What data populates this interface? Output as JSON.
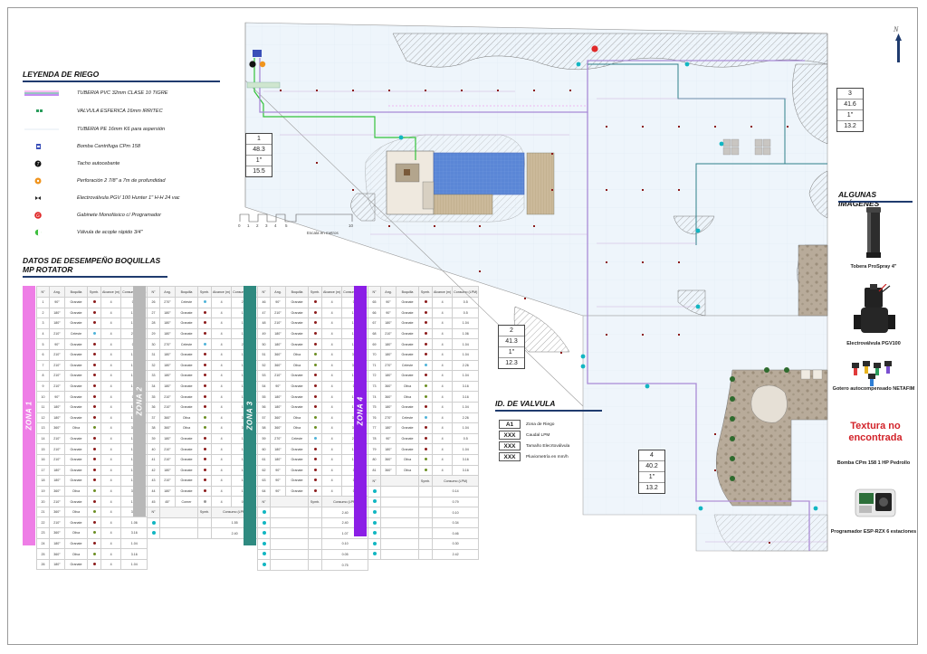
{
  "legend": {
    "title": "LEYENDA DE RIEGO",
    "items": [
      {
        "label": "TUBERIA PVC 32mm CLASE 10 TIGRE",
        "icon": "pvc-pipe-line"
      },
      {
        "label": "VALVULA ESFERICA 16mm IRRITEC",
        "icon": "ball-valve"
      },
      {
        "label": "TUBERIA PE 16mm K6 para aspersión",
        "icon": "pe-pipe-line"
      },
      {
        "label": "Bomba Centrifuga CPm 158",
        "icon": "pump"
      },
      {
        "label": "Tacho autocebante",
        "icon": "priming-tank"
      },
      {
        "label": "Perforación 2 7/8\" a 7m de profundidad",
        "icon": "well"
      },
      {
        "label": "Electroválvula PGV 100 Hunter 1\" H-H 24 vac",
        "icon": "solenoid-valve"
      },
      {
        "label": "Gabinete Monofásico c/ Programador",
        "icon": "cabinet"
      },
      {
        "label": "Válvula de acople rápido 3/4\"",
        "icon": "quick-coupler"
      }
    ]
  },
  "scale": {
    "labels": [
      "0",
      "1",
      "2",
      "3",
      "4",
      "5",
      "10"
    ],
    "caption": "Escala en metros"
  },
  "performance": {
    "title_line1": "DATOS DE DESEMPEÑO BOQUILLAS",
    "title_line2": "MP ROTATOR"
  },
  "table_headers": [
    "N°",
    "Ang.",
    "Boquilla",
    "Symb.",
    "Alcance (m)",
    "Consumo (LPM)"
  ],
  "table_bottom_headers": [
    "N°",
    "",
    "Symb.",
    "Consumo (LPM)"
  ],
  "zones": [
    {
      "label": "ZONA 1",
      "color": "#ee7ee6",
      "rows": [
        [
          "1",
          "90°",
          "Granate",
          "",
          "4",
          "0.5"
        ],
        [
          "2",
          "180°",
          "Granate",
          "",
          "4",
          "1.04"
        ],
        [
          "3",
          "180°",
          "Granate",
          "",
          "4",
          "1.04"
        ],
        [
          "4",
          "210°",
          "Celeste",
          "",
          "4",
          "2.35"
        ],
        [
          "5",
          "90°",
          "Granate",
          "",
          "4",
          "0.5"
        ],
        [
          "6",
          "210°",
          "Granate",
          "",
          "4",
          "1.06"
        ],
        [
          "7",
          "210°",
          "Granate",
          "",
          "4",
          "1.06"
        ],
        [
          "8",
          "210°",
          "Granate",
          "",
          "4",
          "1.06"
        ],
        [
          "9",
          "210°",
          "Granate",
          "",
          "4",
          "1.06"
        ],
        [
          "10",
          "90°",
          "Granate",
          "",
          "4",
          "0.5"
        ],
        [
          "11",
          "180°",
          "Granate",
          "",
          "4",
          "1.04"
        ],
        [
          "12",
          "180°",
          "Granate",
          "",
          "4",
          "1.04"
        ],
        [
          "13",
          "360°",
          "Oliva",
          "",
          "4",
          "3.16"
        ],
        [
          "14",
          "210°",
          "Granate",
          "",
          "4",
          "1.04"
        ],
        [
          "15",
          "210°",
          "Granate",
          "",
          "4",
          "1.06"
        ],
        [
          "16",
          "210°",
          "Granate",
          "",
          "4",
          "1.06"
        ],
        [
          "17",
          "180°",
          "Granate",
          "",
          "4",
          "1.06"
        ],
        [
          "18",
          "180°",
          "Granate",
          "",
          "4",
          "1.06"
        ],
        [
          "19",
          "360°",
          "Oliva",
          "",
          "4",
          "3.16"
        ],
        [
          "20",
          "210°",
          "Granate",
          "",
          "4",
          "1.06"
        ],
        [
          "21",
          "360°",
          "Oliva",
          "",
          "4",
          "3.16"
        ],
        [
          "22",
          "210°",
          "Granate",
          "",
          "4",
          "1.06"
        ],
        [
          "23",
          "360°",
          "Oliva",
          "",
          "4",
          "3.16"
        ],
        [
          "24",
          "180°",
          "Granate",
          "",
          "4",
          "1.04"
        ],
        [
          "25",
          "360°",
          "Oliva",
          "",
          "4",
          "3.16"
        ],
        [
          "26",
          "180°",
          "Granate",
          "",
          "4",
          "1.04"
        ]
      ],
      "bottom": []
    },
    {
      "label": "ZONA 2",
      "color": "#b8b8b8",
      "rows": [
        [
          "26",
          "270°",
          "Celeste",
          "",
          "4",
          "2.26"
        ],
        [
          "27",
          "180°",
          "Granate",
          "",
          "4",
          "1.04"
        ],
        [
          "28",
          "180°",
          "Granate",
          "",
          "4",
          "1.04"
        ],
        [
          "29",
          "180°",
          "Granate",
          "",
          "4",
          "1.04"
        ],
        [
          "30",
          "270°",
          "Celeste",
          "",
          "4",
          "2.26"
        ],
        [
          "31",
          "180°",
          "Granate",
          "",
          "4",
          "1.04"
        ],
        [
          "32",
          "180°",
          "Granate",
          "",
          "4",
          "1.04"
        ],
        [
          "33",
          "180°",
          "Granate",
          "",
          "4",
          "1.04"
        ],
        [
          "34",
          "180°",
          "Granate",
          "",
          "4",
          "1.04"
        ],
        [
          "35",
          "210°",
          "Granate",
          "",
          "4",
          "1.06"
        ],
        [
          "36",
          "210°",
          "Granate",
          "",
          "4",
          "1.06"
        ],
        [
          "37",
          "360°",
          "Oliva",
          "",
          "4",
          "3.16"
        ],
        [
          "38",
          "360°",
          "Oliva",
          "",
          "4",
          "3.16"
        ],
        [
          "39",
          "180°",
          "Granate",
          "",
          "4",
          "1.04"
        ],
        [
          "40",
          "210°",
          "Granate",
          "",
          "4",
          "1.06"
        ],
        [
          "41",
          "210°",
          "Granate",
          "",
          "4",
          "1.06"
        ],
        [
          "42",
          "180°",
          "Granate",
          "",
          "4",
          "1.04"
        ],
        [
          "43",
          "210°",
          "Granate",
          "",
          "4",
          "1.06"
        ],
        [
          "44",
          "180°",
          "Granate",
          "",
          "4",
          "1.04"
        ],
        [
          "45",
          "45°",
          "Corner",
          "",
          "4",
          "0.75"
        ]
      ],
      "bottom": [
        [
          "",
          "",
          "",
          "1.55"
        ],
        [
          "",
          "",
          "",
          "2.40"
        ]
      ]
    },
    {
      "label": "ZONA 3",
      "color": "#2f8a80",
      "rows": [
        [
          "46",
          "90°",
          "Granate",
          "",
          "4",
          "0.5"
        ],
        [
          "47",
          "210°",
          "Granate",
          "",
          "4",
          "1.06"
        ],
        [
          "48",
          "210°",
          "Granate",
          "",
          "4",
          "1.06"
        ],
        [
          "49",
          "180°",
          "Granate",
          "",
          "4",
          "1.04"
        ],
        [
          "50",
          "180°",
          "Granate",
          "",
          "4",
          "1.04"
        ],
        [
          "51",
          "360°",
          "Oliva",
          "",
          "4",
          "3.16"
        ],
        [
          "52",
          "360°",
          "Oliva",
          "",
          "4",
          "3.16"
        ],
        [
          "53",
          "210°",
          "Granate",
          "",
          "4",
          "1.06"
        ],
        [
          "54",
          "90°",
          "Granate",
          "",
          "4",
          "0.5"
        ],
        [
          "55",
          "180°",
          "Granate",
          "",
          "4",
          "1.04"
        ],
        [
          "56",
          "180°",
          "Granate",
          "",
          "4",
          "1.04"
        ],
        [
          "57",
          "360°",
          "Oliva",
          "",
          "4",
          "3.16"
        ],
        [
          "58",
          "360°",
          "Oliva",
          "",
          "4",
          "3.16"
        ],
        [
          "59",
          "270°",
          "Celeste",
          "",
          "4",
          "2.26"
        ],
        [
          "60",
          "180°",
          "Granate",
          "",
          "4",
          "1.04"
        ],
        [
          "61",
          "180°",
          "Granate",
          "",
          "4",
          "1.04"
        ],
        [
          "62",
          "90°",
          "Granate",
          "",
          "4",
          "0.5"
        ],
        [
          "63",
          "90°",
          "Granate",
          "",
          "4",
          "0.5"
        ],
        [
          "64",
          "90°",
          "Granate",
          "",
          "4",
          "0.5"
        ]
      ],
      "bottom": [
        [
          "",
          "",
          "",
          "2.40"
        ],
        [
          "",
          "",
          "",
          "2.40"
        ],
        [
          "",
          "",
          "",
          "1.07"
        ],
        [
          "",
          "",
          "",
          "0.10"
        ],
        [
          "",
          "",
          "",
          "0.05"
        ],
        [
          "",
          "",
          "",
          "0.75"
        ]
      ]
    },
    {
      "label": "ZONA 4",
      "color": "#8b1ee6",
      "rows": [
        [
          "65",
          "90°",
          "Granate",
          "",
          "4",
          "0.5"
        ],
        [
          "66",
          "90°",
          "Granate",
          "",
          "4",
          "0.5"
        ],
        [
          "67",
          "180°",
          "Granate",
          "",
          "4",
          "1.04"
        ],
        [
          "68",
          "210°",
          "Granate",
          "",
          "4",
          "1.06"
        ],
        [
          "69",
          "180°",
          "Granate",
          "",
          "4",
          "1.04"
        ],
        [
          "70",
          "180°",
          "Granate",
          "",
          "4",
          "1.04"
        ],
        [
          "71",
          "270°",
          "Celeste",
          "",
          "4",
          "2.26"
        ],
        [
          "72",
          "180°",
          "Granate",
          "",
          "4",
          "1.04"
        ],
        [
          "73",
          "360°",
          "Oliva",
          "",
          "4",
          "3.16"
        ],
        [
          "74",
          "360°",
          "Oliva",
          "",
          "4",
          "3.16"
        ],
        [
          "75",
          "180°",
          "Granate",
          "",
          "4",
          "1.04"
        ],
        [
          "76",
          "270°",
          "Celeste",
          "",
          "4",
          "2.26"
        ],
        [
          "77",
          "180°",
          "Granate",
          "",
          "4",
          "1.04"
        ],
        [
          "78",
          "90°",
          "Granate",
          "",
          "4",
          "0.5"
        ],
        [
          "79",
          "180°",
          "Granate",
          "",
          "4",
          "1.04"
        ],
        [
          "80",
          "360°",
          "Oliva",
          "",
          "4",
          "3.16"
        ],
        [
          "81",
          "360°",
          "Oliva",
          "",
          "4",
          "3.16"
        ]
      ],
      "bottom": [
        [
          "",
          "",
          "",
          "0.14"
        ],
        [
          "",
          "",
          "",
          "0.79"
        ],
        [
          "",
          "",
          "",
          "0.10"
        ],
        [
          "",
          "",
          "",
          "0.34"
        ],
        [
          "",
          "",
          "",
          "0.46"
        ],
        [
          "",
          "",
          "",
          "0.30"
        ],
        [
          "",
          "",
          "",
          "2.42"
        ]
      ]
    }
  ],
  "valve_boxes": [
    {
      "values": [
        "1",
        "48.3",
        "1\"",
        "15.5"
      ]
    },
    {
      "values": [
        "2",
        "41.3",
        "1\"",
        "12.3"
      ]
    },
    {
      "values": [
        "3",
        "41.6",
        "1\"",
        "13.2"
      ]
    },
    {
      "values": [
        "4",
        "40.2",
        "1\"",
        "13.2"
      ]
    }
  ],
  "valve_id": {
    "title": "ID. DE VALVULA",
    "rows": [
      {
        "key": "A1",
        "text": "Zona de Riego"
      },
      {
        "key": "XXX",
        "text": "Caudal LPM"
      },
      {
        "key": "XXX",
        "text": "Tamaño Elecrtoválvula"
      },
      {
        "key": "XXX",
        "text": "Pluviometría en mm/h"
      }
    ]
  },
  "images": {
    "title": "ALGUNAS IMÁGENES",
    "items": [
      {
        "caption": "Tobera ProSpray 4\""
      },
      {
        "caption": "Electroválvula PGV100"
      },
      {
        "caption": "Gotero autocompensado NETAFIM"
      },
      {
        "caption": "Bomba CPm 158 1 HP Pedrollo",
        "missing_text": "Textura no encontrada"
      },
      {
        "caption": "Programador ESP-RZX 6 estaciones"
      }
    ]
  },
  "colors": {
    "zone1": "#ee7ee6",
    "zone2": "#b8b8b8",
    "zone3": "#2f8a80",
    "zone4": "#8b1ee6",
    "main_pipe": "#a98ad6",
    "green_pipe": "#33c23a",
    "blue_pipe": "#2f7f8a",
    "pool": "#5a86d6",
    "deck": "#c9b99a",
    "title_underline": "#1f3b6e",
    "missing_texture": "#d2232a"
  }
}
